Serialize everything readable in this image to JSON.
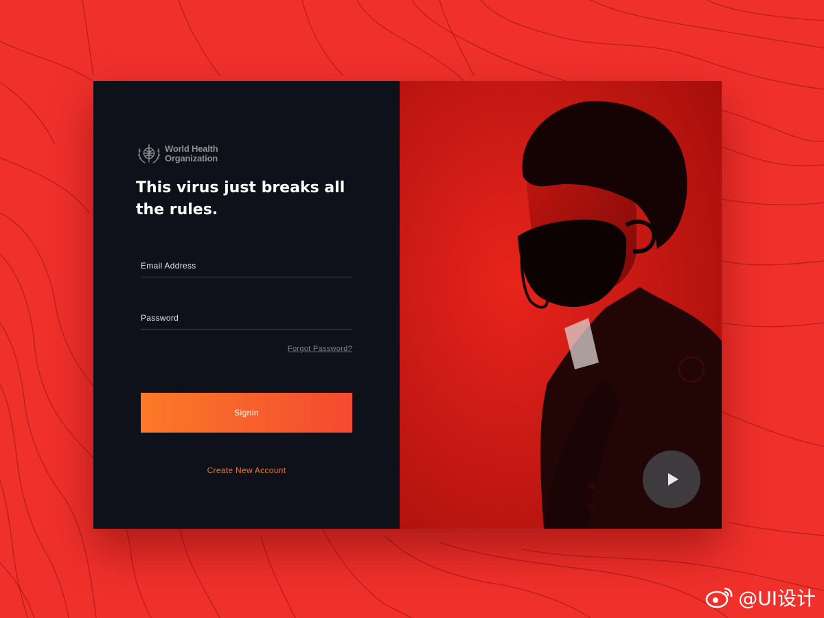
{
  "brand": {
    "org_line1": "World Health",
    "org_line2": "Organization",
    "logo_icon": "who-emblem-icon"
  },
  "hero": {
    "headline": "This virus just breaks all the rules."
  },
  "form": {
    "email_label": "Email Address",
    "password_label": "Password",
    "forgot_link": "Forgot Password?",
    "signin_label": "Signin",
    "create_account_link": "Create New Account"
  },
  "media": {
    "play_icon": "play-icon"
  },
  "watermark": {
    "text": "@UI设计",
    "icon": "weibo-icon"
  },
  "colors": {
    "background": "#f0302b",
    "panel": "#0e111a",
    "accent_start": "#fb7a28",
    "accent_end": "#f34a30",
    "link_accent": "#f2762c"
  }
}
